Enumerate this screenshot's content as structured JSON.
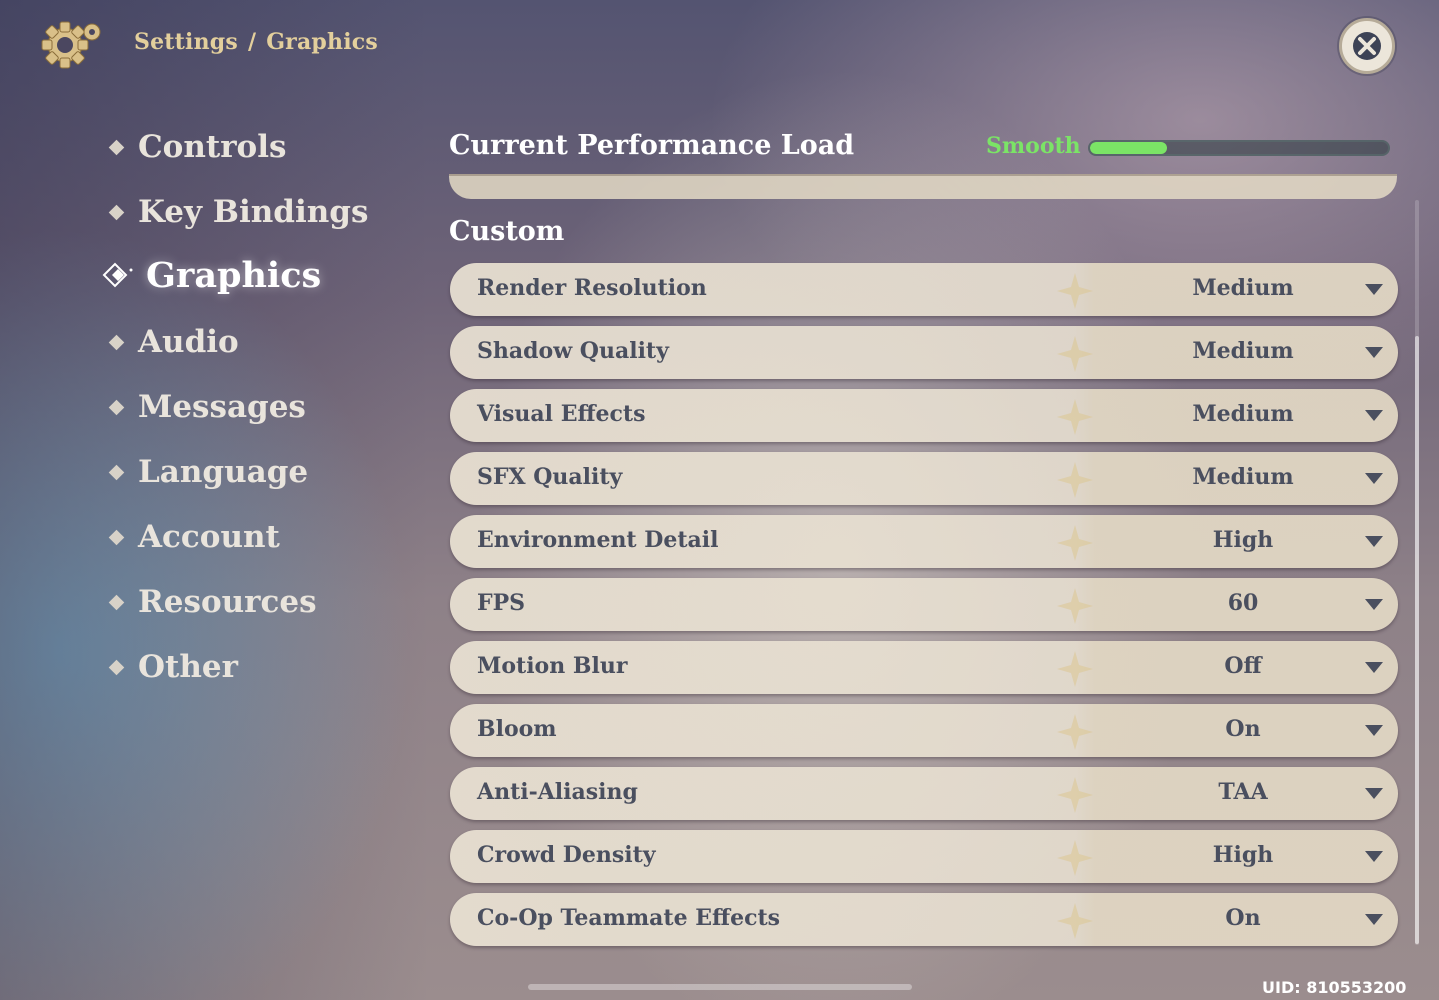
{
  "header": {
    "breadcrumb_root": "Settings",
    "breadcrumb_sep": "/",
    "breadcrumb_current": "Graphics"
  },
  "nav": {
    "items": [
      {
        "label": "Controls",
        "active": false
      },
      {
        "label": "Key Bindings",
        "active": false
      },
      {
        "label": "Graphics",
        "active": true
      },
      {
        "label": "Audio",
        "active": false
      },
      {
        "label": "Messages",
        "active": false
      },
      {
        "label": "Language",
        "active": false
      },
      {
        "label": "Account",
        "active": false
      },
      {
        "label": "Resources",
        "active": false
      },
      {
        "label": "Other",
        "active": false
      }
    ]
  },
  "performance": {
    "title": "Current Performance Load",
    "status": "Smooth",
    "status_color": "#7be466",
    "load_fraction": 0.26
  },
  "section": {
    "title": "Custom"
  },
  "settings": [
    {
      "label": "Render Resolution",
      "value": "Medium"
    },
    {
      "label": "Shadow Quality",
      "value": "Medium"
    },
    {
      "label": "Visual Effects",
      "value": "Medium"
    },
    {
      "label": "SFX Quality",
      "value": "Medium"
    },
    {
      "label": "Environment Detail",
      "value": "High"
    },
    {
      "label": "FPS",
      "value": "60"
    },
    {
      "label": "Motion Blur",
      "value": "Off"
    },
    {
      "label": "Bloom",
      "value": "On"
    },
    {
      "label": "Anti-Aliasing",
      "value": "TAA"
    },
    {
      "label": "Crowd Density",
      "value": "High"
    },
    {
      "label": "Co-Op Teammate Effects",
      "value": "On"
    }
  ],
  "footer": {
    "uid": "UID: 810553200"
  },
  "icons": {
    "settings": "gear-icon",
    "close": "close-icon",
    "dropdown": "caret-down-icon",
    "nav_bullet": "diamond-icon"
  },
  "colors": {
    "accent_gold": "#e3cf9c",
    "row_text": "#4a4f5f",
    "row_bg": "#e9e1d2"
  }
}
